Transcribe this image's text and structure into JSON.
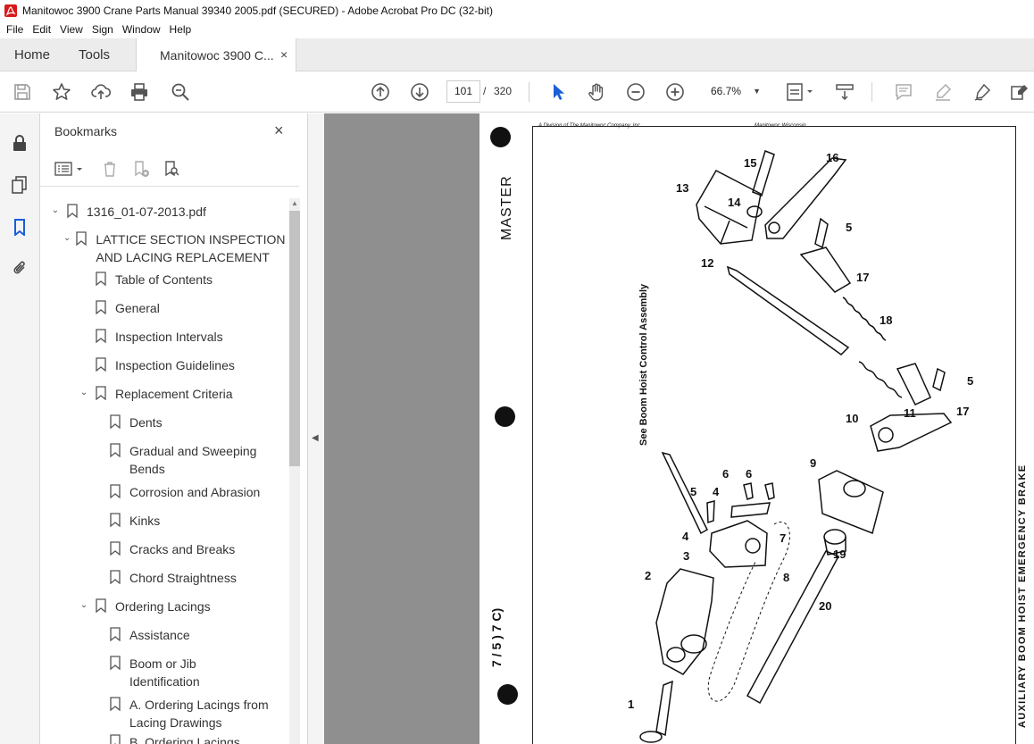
{
  "window": {
    "title": "Manitowoc 3900 Crane Parts Manual 39340 2005.pdf (SECURED) - Adobe Acrobat Pro DC (32-bit)",
    "app_icon": "acrobat-icon"
  },
  "menu": [
    "File",
    "Edit",
    "View",
    "Sign",
    "Window",
    "Help"
  ],
  "tabs": {
    "home": "Home",
    "tools": "Tools",
    "document": "Manitowoc 3900 C...",
    "close": "×"
  },
  "toolbar": {
    "current_page": "101",
    "separator": "/",
    "total_pages": "320",
    "zoom": "66.7%",
    "icons": [
      "save-icon",
      "star-icon",
      "upload-icon",
      "print-icon",
      "zoom-search-icon",
      "page-up-icon",
      "page-down-icon",
      "select-cursor-icon",
      "hand-icon",
      "zoom-out-icon",
      "zoom-in-icon",
      "page-fit-icon",
      "scroll-mode-icon",
      "comment-icon",
      "highlight-icon",
      "sign-icon",
      "edit-pdf-icon"
    ]
  },
  "bookmarks": {
    "title": "Bookmarks",
    "close": "×",
    "items": [
      {
        "label": "1316_01-07-2013.pdf",
        "level": 0,
        "expanded": true
      },
      {
        "label": "LATTICE SECTION INSPECTION AND LACING REPLACEMENT",
        "level": 1,
        "expanded": true
      },
      {
        "label": "Table of Contents",
        "level": 2
      },
      {
        "label": "General",
        "level": 2
      },
      {
        "label": "Inspection Intervals",
        "level": 2
      },
      {
        "label": "Inspection Guidelines",
        "level": 2
      },
      {
        "label": "Replacement Criteria",
        "level": 2,
        "expanded": true
      },
      {
        "label": "Dents",
        "level": 3
      },
      {
        "label": "Gradual and Sweeping Bends",
        "level": 3
      },
      {
        "label": "Corrosion and Abrasion",
        "level": 3
      },
      {
        "label": "Kinks",
        "level": 3
      },
      {
        "label": "Cracks and Breaks",
        "level": 3
      },
      {
        "label": "Chord Straightness",
        "level": 3
      },
      {
        "label": "Ordering Lacings",
        "level": 2,
        "expanded": true
      },
      {
        "label": "Assistance",
        "level": 3
      },
      {
        "label": "Boom or Jib Identification",
        "level": 3
      },
      {
        "label": "A. Ordering Lacings from Lacing Drawings",
        "level": 3
      },
      {
        "label": "B. Ordering Lacings",
        "level": 3
      }
    ]
  },
  "document_page": {
    "header_left": "A Division of The Manitowoc Company, Inc.",
    "header_right": "Manitowoc  Wisconsin",
    "margin_label": "MASTER",
    "assembly_note": "See Boom Hoist Control Assembly",
    "side_title": "AUXILIARY BOOM HOIST EMERGENCY BRAKE",
    "margin_mark": "7 / 5 ) 7 C)",
    "part_numbers": [
      "1",
      "2",
      "3",
      "4",
      "4",
      "5",
      "5",
      "5",
      "6",
      "6",
      "7",
      "8",
      "9",
      "10",
      "11",
      "12",
      "13",
      "14",
      "15",
      "16",
      "17",
      "17",
      "18",
      "19",
      "20"
    ]
  }
}
